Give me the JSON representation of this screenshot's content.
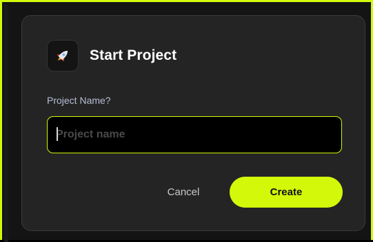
{
  "colors": {
    "accent": "#d4f80a",
    "dialog_background": "#242424",
    "page_background": "#141414"
  },
  "dialog": {
    "icon": "rocket-icon",
    "title": "Start Project",
    "field_label": "Project Name?",
    "input": {
      "value": "",
      "placeholder": "Project name"
    },
    "cancel_label": "Cancel",
    "create_label": "Create"
  }
}
